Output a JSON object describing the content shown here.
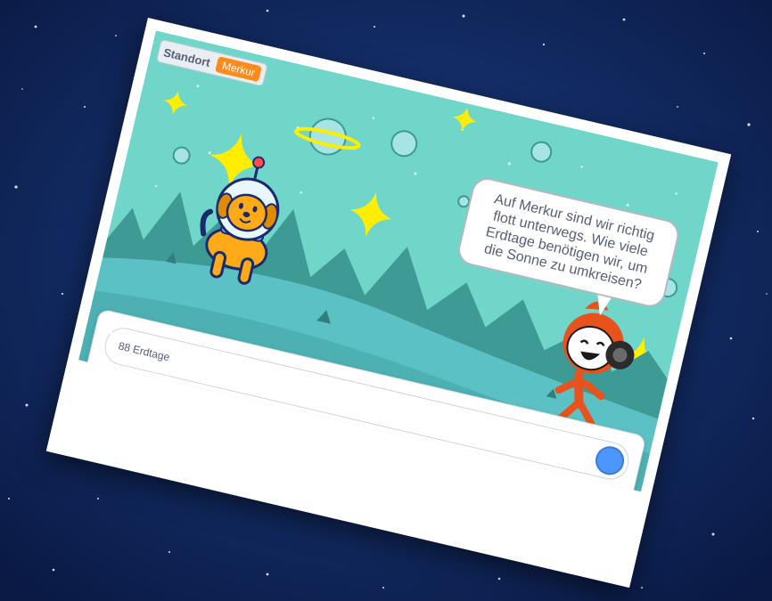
{
  "variable_monitor": {
    "name": "Standort",
    "value": "Merkur"
  },
  "speech_bubble": {
    "text": "Auf Merkur sind wir richtig flott unterwegs. Wie viele Erdtage benötigen wir, um die Sonne zu umkreisen?"
  },
  "ask_prompt": {
    "answer_value": "88 Erdtage",
    "submit_icon": "checkmark-icon"
  },
  "colors": {
    "sky": "#6fd6c9",
    "mountains": "#3e9a94",
    "ground": "#5cc1c4",
    "star": "#ffee00",
    "monitor_value_bg": "#ff8c1a",
    "submit_button": "#4c97ff"
  }
}
